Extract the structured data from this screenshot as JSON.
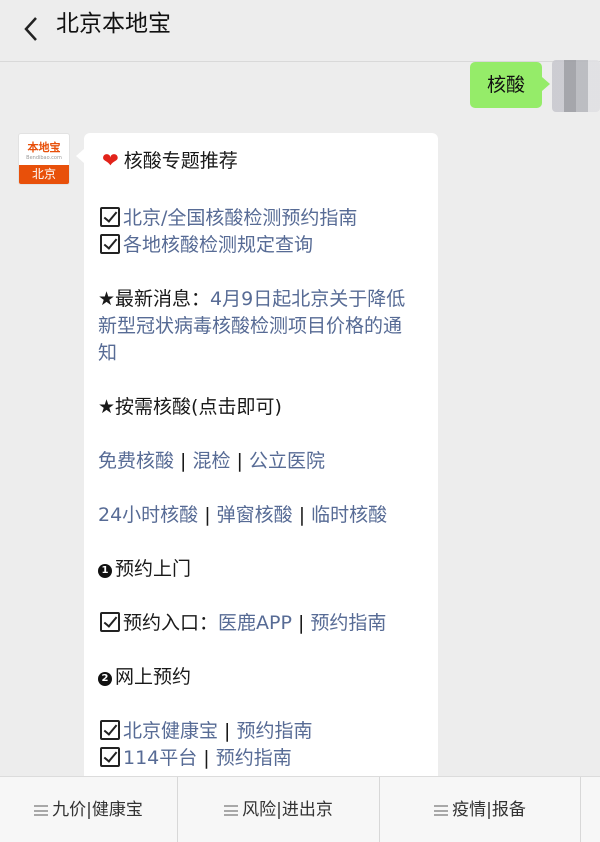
{
  "header": {
    "title": "北京本地宝"
  },
  "outgoing": {
    "text": "核酸"
  },
  "avatar": {
    "brand": "本地宝",
    "site": "Bendibao.com",
    "city": "北京"
  },
  "message": {
    "heading": "核酸专题推荐",
    "check1": "北京/全国核酸检测预约指南",
    "check2": "各地核酸检测规定查询",
    "news_prefix": "★最新消息：",
    "news_line1": "4月9日起北京关于降低",
    "news_line2": "新型冠状病毒核酸检测项目价格的通",
    "news_line3": "知",
    "ondemand": "★按需核酸(点击即可)",
    "row1": {
      "a": "免费核酸",
      "b": "混检",
      "c": "公立医院"
    },
    "row2": {
      "a": "24小时核酸",
      "b": "弹窗核酸",
      "c": "临时核酸"
    },
    "sep": " | ",
    "sec1_num": "1",
    "sec1_title": "预约上门",
    "entry_label": "预约入口：",
    "entry_app": "医鹿APP",
    "guide": "预约指南",
    "sec2_num": "2",
    "sec2_title": "网上预约",
    "online1": "北京健康宝",
    "online2": "114平台"
  },
  "menu": [
    {
      "label": "九价|健康宝"
    },
    {
      "label": "风险|进出京"
    },
    {
      "label": "疫情|报备"
    }
  ],
  "colors": {
    "link": "#576b95",
    "outgoing_bubble": "#95ec69",
    "brand": "#e8500a",
    "background": "#ededed"
  }
}
